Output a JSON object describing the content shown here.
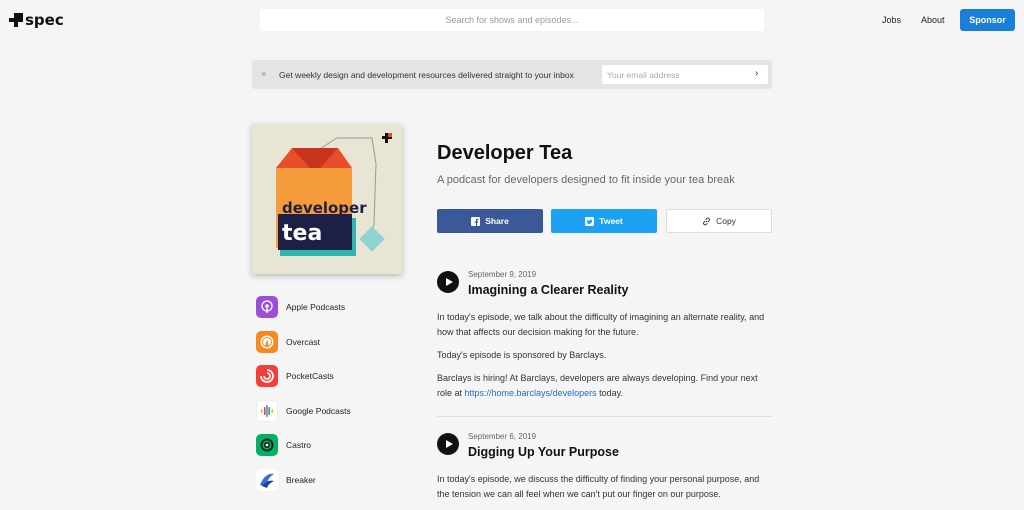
{
  "header": {
    "logo_text": "spec",
    "search_placeholder": "Search for shows and episodes...",
    "nav": [
      "Jobs",
      "About"
    ],
    "sponsor_label": "Sponsor"
  },
  "newsletter": {
    "close_glyph": "×",
    "text": "Get weekly design and development resources delivered straight to your inbox",
    "email_placeholder": "Your email address",
    "submit_glyph": "›"
  },
  "podcast": {
    "title": "Developer Tea",
    "description": "A podcast for developers designed to fit inside your tea break",
    "cover_text_top": "developer",
    "cover_text_bottom": "tea"
  },
  "share": {
    "facebook_label": "Share",
    "twitter_label": "Tweet",
    "copy_label": "Copy"
  },
  "apps": [
    {
      "label": "Apple Podcasts",
      "icon": "apple-podcasts-icon",
      "color": "#9b4fd8"
    },
    {
      "label": "Overcast",
      "icon": "overcast-icon",
      "color": "#f58a1f"
    },
    {
      "label": "PocketCasts",
      "icon": "pocketcasts-icon",
      "color": "#f43e37"
    },
    {
      "label": "Google Podcasts",
      "icon": "google-podcasts-icon",
      "color": "#ffffff"
    },
    {
      "label": "Castro",
      "icon": "castro-icon",
      "color": "#00b265"
    },
    {
      "label": "Breaker",
      "icon": "breaker-icon",
      "color": "#ffffff"
    }
  ],
  "episodes": [
    {
      "date": "September 9, 2019",
      "title": "Imagining a Clearer Reality",
      "paragraphs": [
        "In today's episode, we talk about the difficulty of imagining an alternate reality, and how that affects our decision making for the future.",
        "Today's episode is sponsored by Barclays."
      ],
      "para3_before": "Barclays is hiring! At Barclays, developers are always developing. Find your next role at ",
      "para3_link": "https://home.barclays/developers",
      "para3_after": " today."
    },
    {
      "date": "September 6, 2019",
      "title": "Digging Up Your Purpose",
      "paragraphs": [
        "In today's episode, we discuss the difficulty of finding your personal purpose, and the tension we can all feel when we can't put our finger on our purpose."
      ]
    }
  ],
  "colors": {
    "sponsor": "#1a7fd8",
    "facebook": "#3b5998",
    "twitter": "#1da1f2",
    "link": "#1a6fc9"
  }
}
